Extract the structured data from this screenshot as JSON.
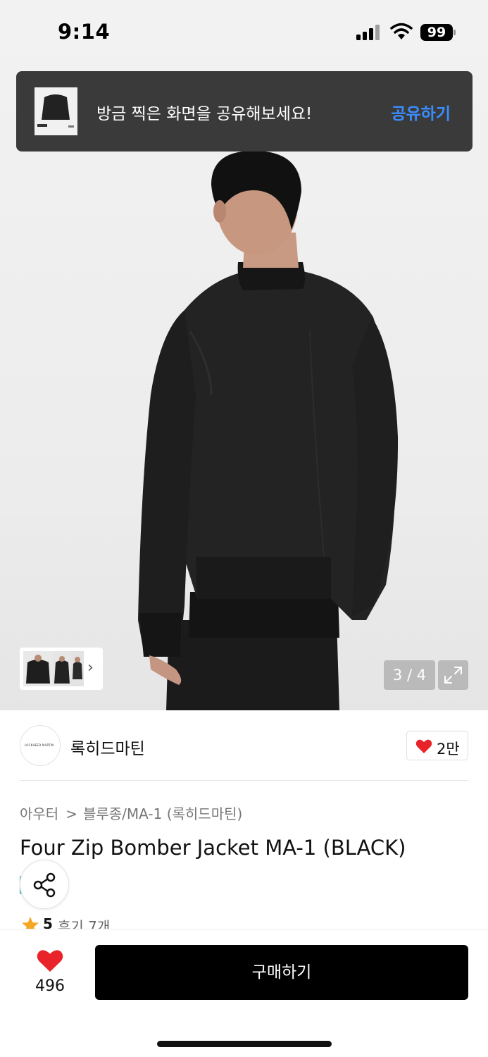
{
  "status_bar": {
    "time": "9:14",
    "battery": "99"
  },
  "share_toast": {
    "message": "방금 찍은 화면을 공유해보세요!",
    "action_label": "공유하기"
  },
  "gallery": {
    "counter": "3 / 4",
    "thumbnail_chevron": "›"
  },
  "brand": {
    "name": "록히드마틴",
    "logo_text": "LOCKHEED MARTIN",
    "likes": "2만"
  },
  "breadcrumb": {
    "category": "아우터",
    "separator": ">",
    "subcategory": "블루종/MA-1 (록히드마틴)"
  },
  "product": {
    "title": "Four Zip Bomber Jacket MA-1 (BLACK)",
    "rating": "5",
    "reviews": "후기 7개"
  },
  "bottom_bar": {
    "wishlist_count": "496",
    "buy_label": "구매하기"
  },
  "colors": {
    "accent_blue": "#3b8cff",
    "heart_red": "#e8232a",
    "star_orange": "#f5a623",
    "buy_button": "#000000"
  },
  "icons": [
    "signal-icon",
    "wifi-icon",
    "battery-icon",
    "chevron-right-icon",
    "expand-icon",
    "heart-icon",
    "share-icon",
    "star-icon"
  ]
}
